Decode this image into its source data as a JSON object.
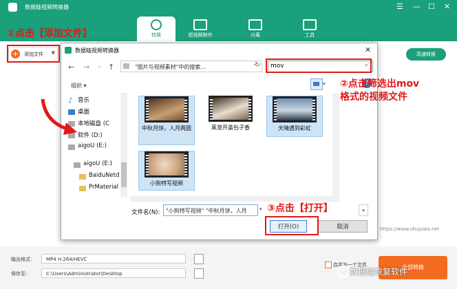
{
  "app": {
    "title": "数据蛙视频转换器",
    "window_controls": [
      "☰",
      "—",
      "☐",
      "✕"
    ],
    "tabs": [
      {
        "label": "转换",
        "icon": "convert-icon"
      },
      {
        "label": "短视频制作",
        "icon": "video-icon"
      },
      {
        "label": "分离",
        "icon": "separate-icon"
      },
      {
        "label": "工具",
        "icon": "toolbox-icon"
      }
    ],
    "add_file_label": "添加文件",
    "high_speed_label": "高速转换",
    "output_format_label": "输出格式:",
    "output_format_value": "MP4 H.264/HEVC",
    "save_to_label": "保存至:",
    "save_to_value": "C:\\Users\\Administrator\\Desktop",
    "merge_label": "合并为一个文件",
    "convert_all_label": "全部转换",
    "website": "https://www.shujuwa.net",
    "accent_color": "#1aa07a",
    "orange_color": "#f26b21"
  },
  "dialog": {
    "title": "数据蛙视频转换器",
    "close": "✕",
    "nav_back": "←",
    "nav_forward": "→",
    "nav_dropdown": "⌄",
    "nav_up": "↑",
    "address": "\"图片与视频素材\"中的搜索...",
    "search_value": "mov",
    "organize_label": "组织 ▾",
    "help": "?",
    "tree": [
      {
        "label": "音乐",
        "icon": "music-icon"
      },
      {
        "label": "桌面",
        "icon": "desktop-icon"
      },
      {
        "label": "本地磁盘 (C",
        "icon": "drive-icon"
      },
      {
        "label": "软件 (D:)",
        "icon": "drive-icon"
      },
      {
        "label": "aigoU (E:)",
        "icon": "drive-icon"
      },
      {
        "label": "aigoU (E:)",
        "icon": "drive-icon"
      },
      {
        "label": "BaiduNetd",
        "icon": "folder-icon"
      },
      {
        "label": "PrMaterial",
        "icon": "folder-icon"
      }
    ],
    "files": [
      {
        "name": "中秋月饼，人月两圆"
      },
      {
        "name": "蒸笼开盖包子香"
      },
      {
        "name": "天晴遇到彩虹"
      },
      {
        "name": "小狗特写视频"
      }
    ],
    "filename_label": "文件名(N):",
    "filename_value": "\"小狗特写视频\" \"中秋月饼，人月",
    "open_label": "打开(O)",
    "cancel_label": "取消"
  },
  "annotations": {
    "step1": "①点击【添加文件】",
    "step2_line1": "②点击筛选出mov",
    "step2_line2": "格式的视频文件",
    "step3": "③点击【打开】",
    "highlight_color": "#e01818"
  },
  "watermark": "数据蛙恢复软件"
}
